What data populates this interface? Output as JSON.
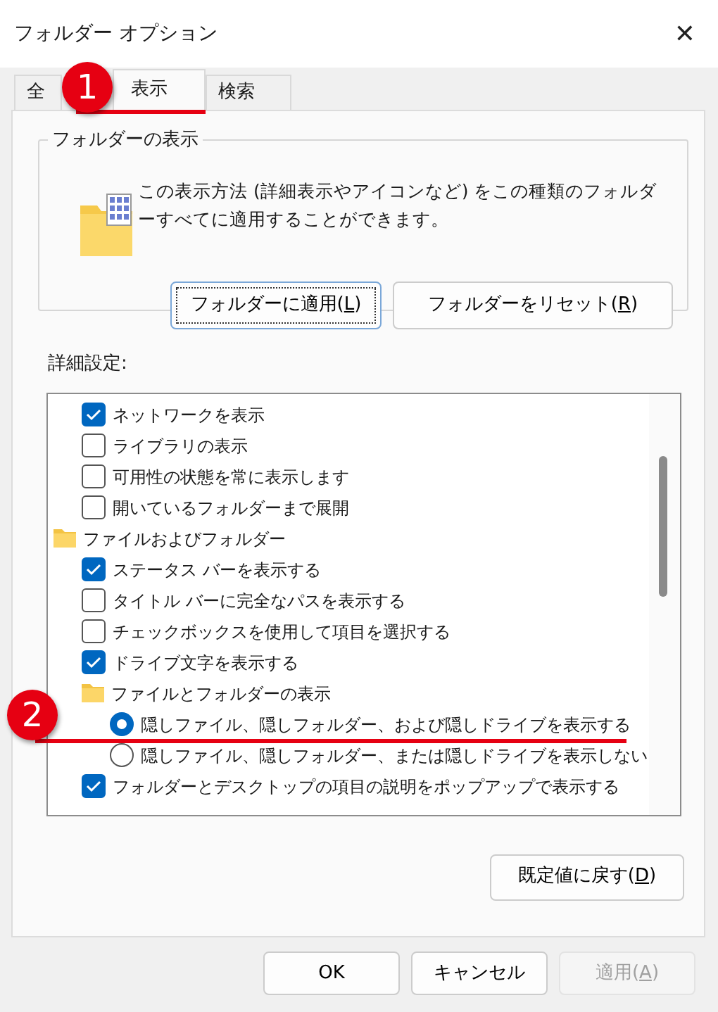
{
  "window": {
    "title": "フォルダー オプション",
    "close": "✕"
  },
  "tabs": [
    {
      "label": "全",
      "selected": false
    },
    {
      "label": "表示",
      "selected": true
    },
    {
      "label": "検索",
      "selected": false
    }
  ],
  "folder_views": {
    "title": "フォルダーの表示",
    "description": "この表示方法 (詳細表示やアイコンなど) をこの種類のフォルダーすべてに適用することができます。",
    "buttons": [
      {
        "label": "フォルダーに適用(**L**)",
        "focused": true
      },
      {
        "label": "フォルダーをリセット(**R**)",
        "focused": false
      }
    ]
  },
  "advanced": {
    "label": "詳細設定:",
    "items": [
      {
        "kind": "continued",
        "children": [
          {
            "kind": "checkbox",
            "label": "ネットワークを表示",
            "checked": true
          },
          {
            "kind": "checkbox",
            "label": "ライブラリの表示",
            "checked": false
          },
          {
            "kind": "checkbox",
            "label": "可用性の状態を常に表示します",
            "checked": false
          },
          {
            "kind": "checkbox",
            "label": "開いているフォルダーまで展開",
            "checked": false
          }
        ]
      },
      {
        "kind": "folder",
        "label": "ファイルおよびフォルダー",
        "children": [
          {
            "kind": "checkbox",
            "label": "ステータス バーを表示する",
            "checked": true
          },
          {
            "kind": "checkbox",
            "label": "タイトル バーに完全なパスを表示する",
            "checked": false
          },
          {
            "kind": "checkbox",
            "label": "チェックボックスを使用して項目を選択する",
            "checked": false
          },
          {
            "kind": "checkbox",
            "label": "ドライブ文字を表示する",
            "checked": true
          },
          {
            "kind": "folder",
            "label": "ファイルとフォルダーの表示",
            "children": [
              {
                "kind": "radio",
                "label": "隠しファイル、隠しフォルダー、および隠しドライブを表示する",
                "selected": true
              },
              {
                "kind": "radio",
                "label": "隠しファイル、隠しフォルダー、または隠しドライブを表示しない",
                "selected": false
              }
            ]
          },
          {
            "kind": "checkbox",
            "label": "フォルダーとデスクトップの項目の説明をポップアップで表示する",
            "checked": true
          }
        ]
      }
    ],
    "restore_button": {
      "label": "既定値に戻す(**D**)"
    }
  },
  "buttons": [
    {
      "label": "OK",
      "disabled": false
    },
    {
      "label": "キャンセル",
      "disabled": false
    },
    {
      "label": "適用(**A**)",
      "disabled": true
    }
  ],
  "annotations": [
    {
      "label": "1"
    },
    {
      "label": "2"
    }
  ]
}
